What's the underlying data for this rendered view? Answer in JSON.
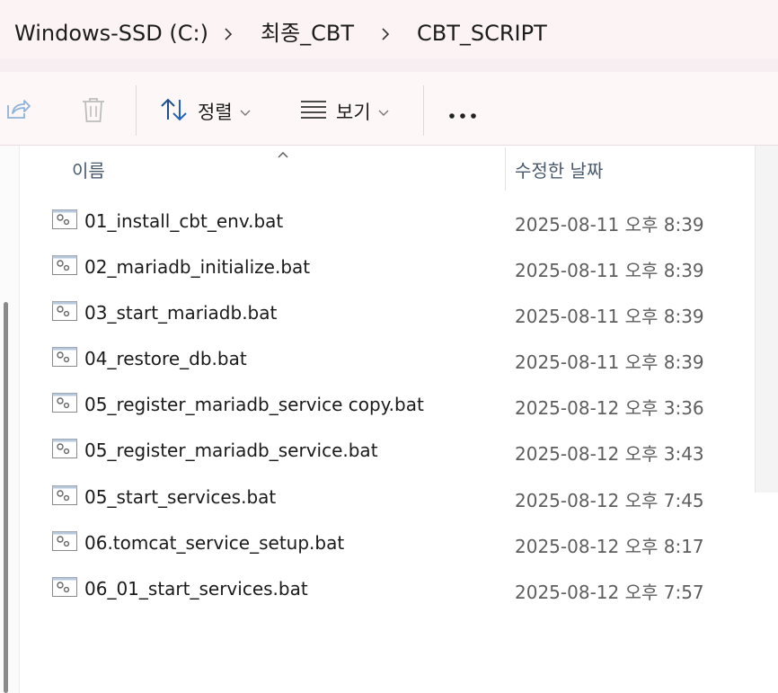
{
  "breadcrumb": {
    "items": [
      "Windows-SSD (C:)",
      "최종_CBT",
      "CBT_SCRIPT"
    ]
  },
  "toolbar": {
    "share_icon": "share-icon",
    "delete_icon": "trash-icon",
    "sort_label": "정렬",
    "view_label": "보기",
    "more_icon": "more-icon"
  },
  "columns": {
    "name": "이름",
    "modified": "수정한 날짜"
  },
  "files": [
    {
      "name": "01_install_cbt_env.bat",
      "modified": "2025-08-11 오후 8:39"
    },
    {
      "name": "02_mariadb_initialize.bat",
      "modified": "2025-08-11 오후 8:39"
    },
    {
      "name": "03_start_mariadb.bat",
      "modified": "2025-08-11 오후 8:39"
    },
    {
      "name": "04_restore_db.bat",
      "modified": "2025-08-11 오후 8:39"
    },
    {
      "name": "05_register_mariadb_service copy.bat",
      "modified": "2025-08-12 오후 3:36"
    },
    {
      "name": "05_register_mariadb_service.bat",
      "modified": "2025-08-12 오후 3:43"
    },
    {
      "name": "05_start_services.bat",
      "modified": "2025-08-12 오후 7:45"
    },
    {
      "name": "06.tomcat_service_setup.bat",
      "modified": "2025-08-12 오후 8:17"
    },
    {
      "name": "06_01_start_services.bat",
      "modified": "2025-08-12 오후 7:57"
    }
  ],
  "colors": {
    "chrome_bg": "#fcf3f5",
    "accent_blue": "#1f63b8"
  }
}
